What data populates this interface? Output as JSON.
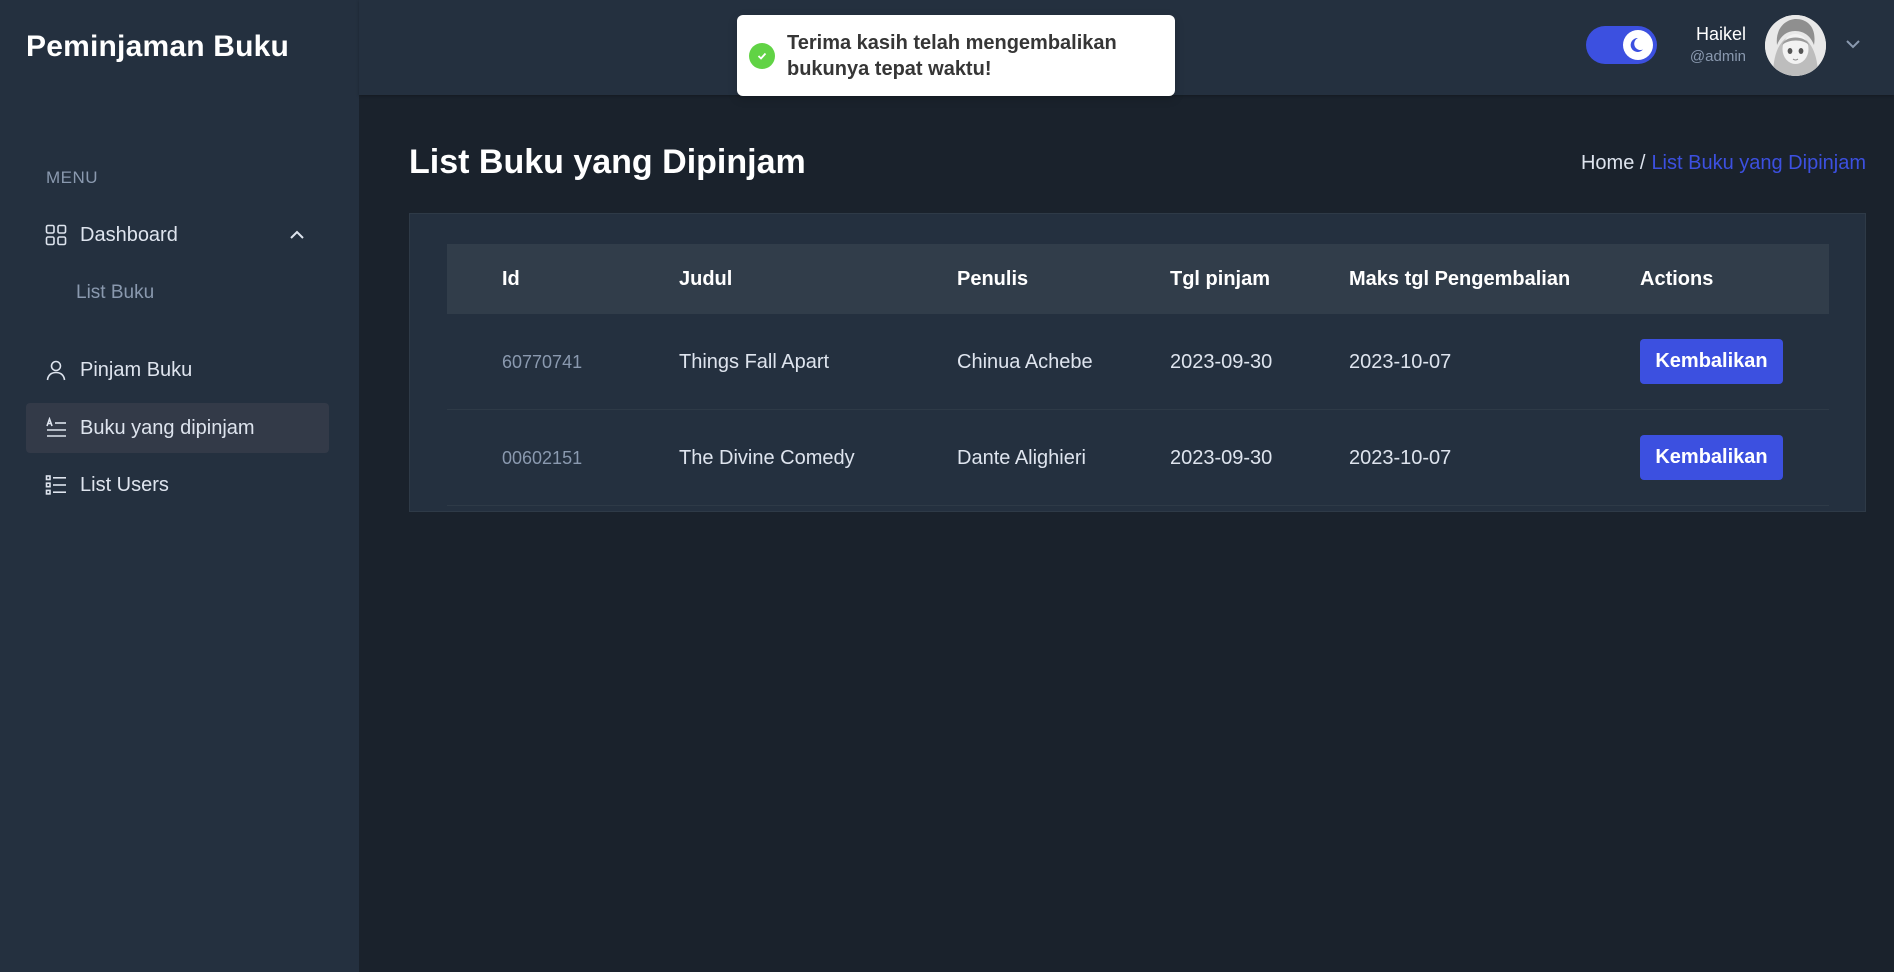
{
  "app": {
    "title": "Peminjaman Buku"
  },
  "sidebar": {
    "menu_heading": "MENU",
    "items": [
      {
        "label": "Dashboard",
        "icon": "dashboard-grid-icon"
      },
      {
        "label": "List Buku"
      },
      {
        "label": "Pinjam Buku",
        "icon": "user-icon"
      },
      {
        "label": "Buku yang dipinjam",
        "icon": "text-align-icon",
        "active": true
      },
      {
        "label": "List Users",
        "icon": "list-icon"
      }
    ]
  },
  "header": {
    "theme_toggle": "dark-mode",
    "user": {
      "name": "Haikel",
      "role": "@admin"
    }
  },
  "toast": {
    "message": "Terima kasih telah mengembalikan bukunya tepat waktu!",
    "status": "success"
  },
  "page": {
    "title": "List Buku yang Dipinjam",
    "breadcrumb": {
      "home": "Home /",
      "current": "List Buku yang Dipinjam"
    }
  },
  "table": {
    "columns": [
      "Id",
      "Judul",
      "Penulis",
      "Tgl pinjam",
      "Maks tgl Pengembalian",
      "Actions"
    ],
    "rows": [
      {
        "id": "60770741",
        "judul": "Things Fall Apart",
        "penulis": "Chinua Achebe",
        "tgl_pinjam": "2023-09-30",
        "maks_tgl": "2023-10-07",
        "action": "Kembalikan"
      },
      {
        "id": "00602151",
        "judul": "The Divine Comedy",
        "penulis": "Dante Alighieri",
        "tgl_pinjam": "2023-09-30",
        "maks_tgl": "2023-10-07",
        "action": "Kembalikan"
      }
    ]
  },
  "colors": {
    "accent": "#3c50e0",
    "sidebar_bg": "#24303f",
    "page_bg": "#1a222c",
    "toast_success": "#61d345"
  }
}
